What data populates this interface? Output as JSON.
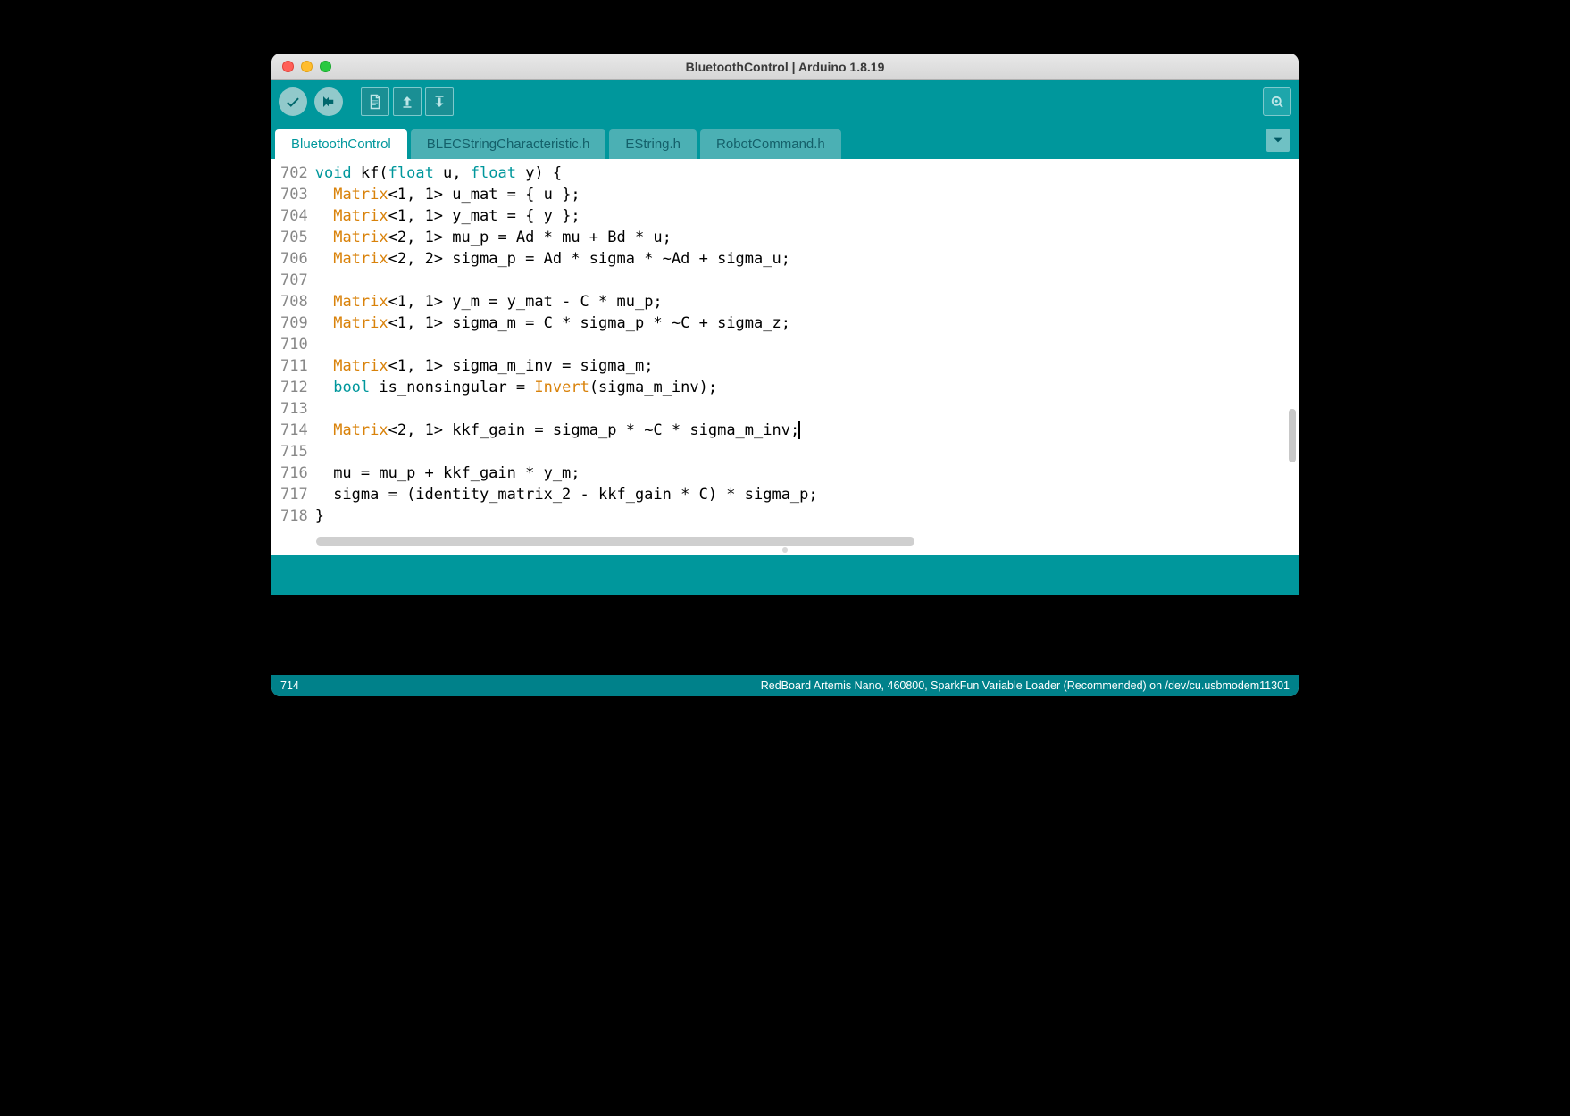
{
  "window": {
    "title": "BluetoothControl | Arduino 1.8.19"
  },
  "tabs": [
    {
      "label": "BluetoothControl",
      "active": true
    },
    {
      "label": "BLECStringCharacteristic.h",
      "active": false
    },
    {
      "label": "EString.h",
      "active": false
    },
    {
      "label": "RobotCommand.h",
      "active": false
    }
  ],
  "gutter": {
    "start": 702,
    "end": 718
  },
  "code_lines": [
    {
      "n": 702,
      "segments": [
        {
          "t": "void",
          "c": "kw-void"
        },
        {
          "t": " kf("
        },
        {
          "t": "float",
          "c": "kw-float"
        },
        {
          "t": " u, "
        },
        {
          "t": "float",
          "c": "kw-float"
        },
        {
          "t": " y) {"
        }
      ]
    },
    {
      "n": 703,
      "segments": [
        {
          "t": "  "
        },
        {
          "t": "Matrix",
          "c": "kw-type"
        },
        {
          "t": "<1, 1> u_mat = { u };"
        }
      ]
    },
    {
      "n": 704,
      "segments": [
        {
          "t": "  "
        },
        {
          "t": "Matrix",
          "c": "kw-type"
        },
        {
          "t": "<1, 1> y_mat = { y };"
        }
      ]
    },
    {
      "n": 705,
      "segments": [
        {
          "t": "  "
        },
        {
          "t": "Matrix",
          "c": "kw-type"
        },
        {
          "t": "<2, 1> mu_p = Ad * mu + Bd * u;"
        }
      ]
    },
    {
      "n": 706,
      "segments": [
        {
          "t": "  "
        },
        {
          "t": "Matrix",
          "c": "kw-type"
        },
        {
          "t": "<2, 2> sigma_p = Ad * sigma * ~Ad + sigma_u;"
        }
      ]
    },
    {
      "n": 707,
      "segments": [
        {
          "t": ""
        }
      ]
    },
    {
      "n": 708,
      "segments": [
        {
          "t": "  "
        },
        {
          "t": "Matrix",
          "c": "kw-type"
        },
        {
          "t": "<1, 1> y_m = y_mat - C * mu_p;"
        }
      ]
    },
    {
      "n": 709,
      "segments": [
        {
          "t": "  "
        },
        {
          "t": "Matrix",
          "c": "kw-type"
        },
        {
          "t": "<1, 1> sigma_m = C * sigma_p * ~C + sigma_z;"
        }
      ]
    },
    {
      "n": 710,
      "segments": [
        {
          "t": ""
        }
      ]
    },
    {
      "n": 711,
      "segments": [
        {
          "t": "  "
        },
        {
          "t": "Matrix",
          "c": "kw-type"
        },
        {
          "t": "<1, 1> sigma_m_inv = sigma_m;"
        }
      ]
    },
    {
      "n": 712,
      "segments": [
        {
          "t": "  "
        },
        {
          "t": "bool",
          "c": "kw-bool"
        },
        {
          "t": " is_nonsingular = "
        },
        {
          "t": "Invert",
          "c": "fn"
        },
        {
          "t": "(sigma_m_inv);"
        }
      ]
    },
    {
      "n": 713,
      "segments": [
        {
          "t": ""
        }
      ]
    },
    {
      "n": 714,
      "segments": [
        {
          "t": "  "
        },
        {
          "t": "Matrix",
          "c": "kw-type"
        },
        {
          "t": "<2, 1> kkf_gain = sigma_p * ~C * sigma_m_inv;"
        }
      ],
      "cursor": true
    },
    {
      "n": 715,
      "segments": [
        {
          "t": ""
        }
      ]
    },
    {
      "n": 716,
      "segments": [
        {
          "t": "  mu = mu_p + kkf_gain * y_m;"
        }
      ]
    },
    {
      "n": 717,
      "segments": [
        {
          "t": "  sigma = (identity_matrix_2 - kkf_gain * C) * sigma_p;"
        }
      ]
    },
    {
      "n": 718,
      "segments": [
        {
          "t": "}"
        }
      ]
    }
  ],
  "status": {
    "line_col": "714",
    "board": "RedBoard Artemis Nano, 460800, SparkFun Variable Loader (Recommended) on /dev/cu.usbmodem11301"
  },
  "toolbar_icons": {
    "verify": "verify-icon",
    "upload": "upload-icon",
    "new": "file-icon",
    "open": "open-icon",
    "save": "save-icon",
    "serial": "serial-monitor-icon"
  }
}
